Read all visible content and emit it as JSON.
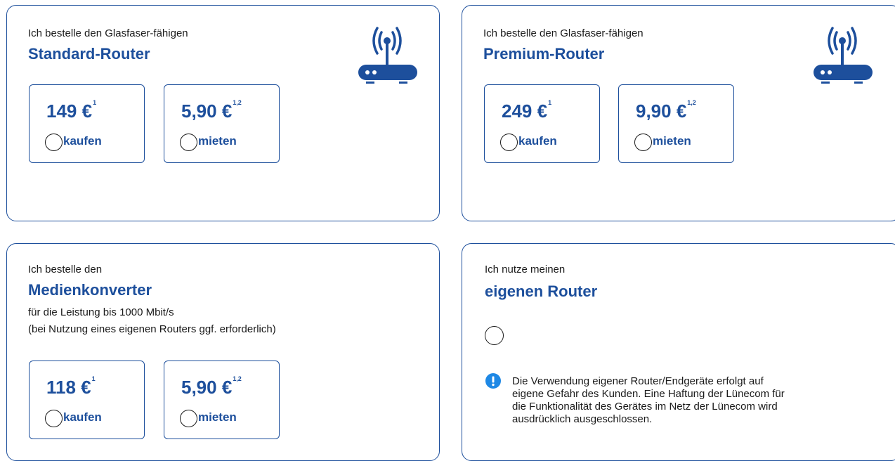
{
  "colors": {
    "brand": "#1d4f9c",
    "border": "#1d4f9c",
    "text": "#1a1a1a",
    "warning": "#1e88e5"
  },
  "cards": {
    "standard": {
      "intro": "Ich bestelle den Glasfaser-fähigen",
      "title": "Standard-Router",
      "icon": "wifi-router-icon",
      "buy": {
        "price": "149 €",
        "note": "1",
        "label": "kaufen"
      },
      "rent": {
        "price": "5,90 €",
        "note": "1,2",
        "label": "mieten"
      }
    },
    "premium": {
      "intro": "Ich bestelle den Glasfaser-fähigen",
      "title": "Premium-Router",
      "icon": "wifi-router-icon",
      "buy": {
        "price": "249 €",
        "note": "1",
        "label": "kaufen"
      },
      "rent": {
        "price": "9,90 €",
        "note": "1,2",
        "label": "mieten"
      }
    },
    "converter": {
      "intro": "Ich bestelle den",
      "title": "Medienkonverter",
      "desc1": "für die Leistung bis 1000 Mbit/s",
      "desc2": "(bei Nutzung eines eigenen Routers ggf. erforderlich)",
      "buy": {
        "price": "118 €",
        "note": "1",
        "label": "kaufen"
      },
      "rent": {
        "price": "5,90 €",
        "note": "1,2",
        "label": "mieten"
      }
    },
    "own": {
      "intro": "Ich nutze meinen",
      "title": "eigenen Router",
      "warning_icon": "exclamation-icon",
      "warning_line1": "Die Verwendung eigener Router/Endgeräte erfolgt auf",
      "warning_line2": "eigene Gefahr des Kunden. Eine Haftung der Lünecom für",
      "warning_line3": "die Funktionalität des Gerätes im Netz der Lünecom wird",
      "warning_line4": "ausdrücklich ausgeschlossen."
    }
  }
}
